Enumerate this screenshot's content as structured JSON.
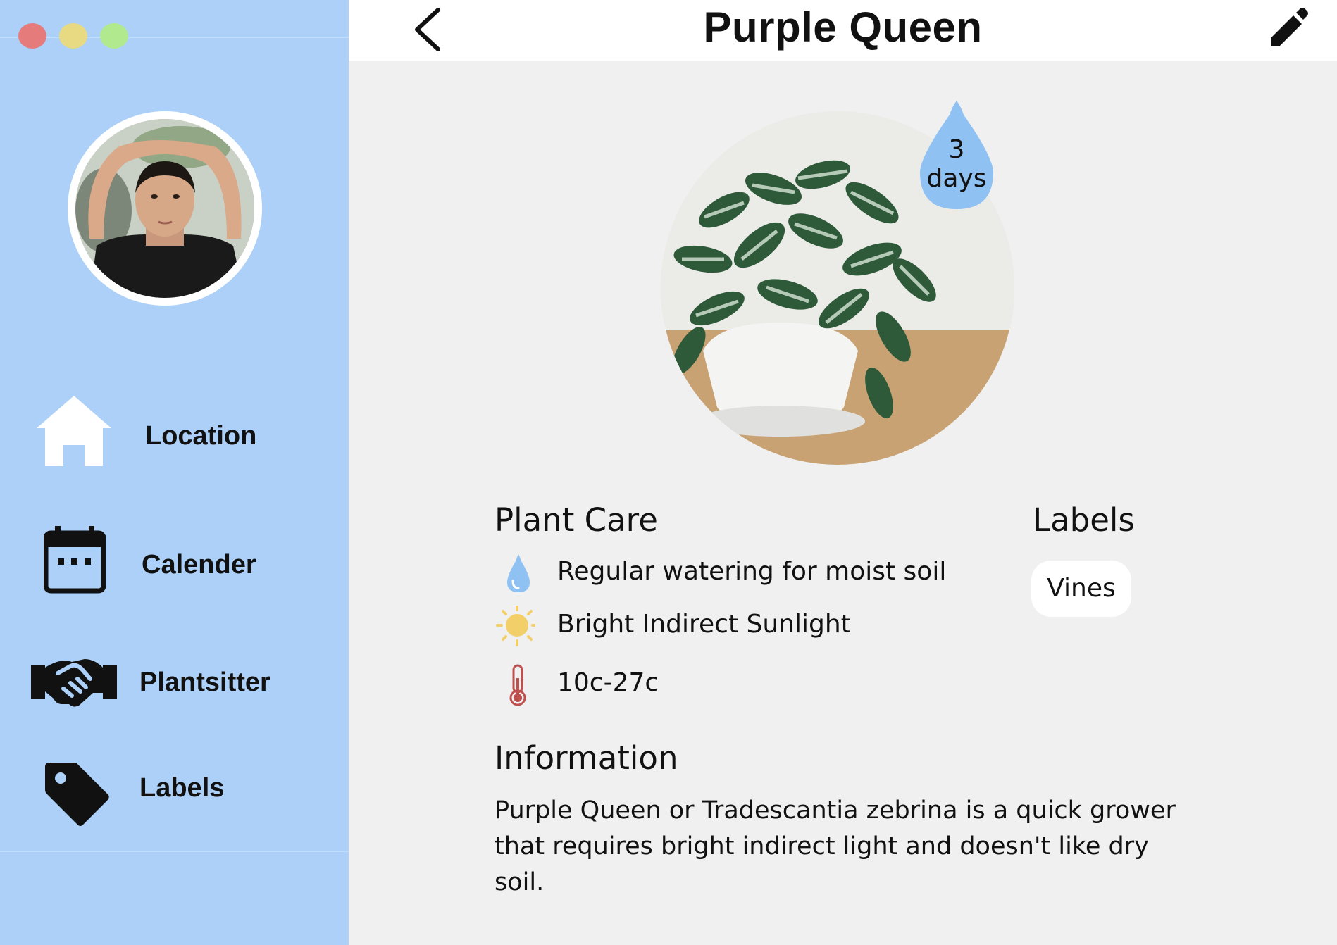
{
  "window": {
    "controls": {
      "close": "#e57b7b",
      "minimize": "#e8da82",
      "maximize": "#b1e98e"
    }
  },
  "sidebar": {
    "background": "#acd0f8",
    "items": [
      {
        "label": "Location",
        "icon": "home-icon"
      },
      {
        "label": "Calender",
        "icon": "calendar-icon"
      },
      {
        "label": "Plantsitter",
        "icon": "handshake-icon"
      },
      {
        "label": "Labels",
        "icon": "tag-icon"
      }
    ]
  },
  "header": {
    "title": "Purple Queen",
    "back_icon": "chevron-left-icon",
    "edit_icon": "pencil-icon"
  },
  "plant": {
    "water_in": {
      "value": "3",
      "unit": "days",
      "color": "#8fc1f3"
    }
  },
  "plant_care": {
    "title": "Plant Care",
    "items": [
      {
        "icon": "water-drop-icon",
        "text": "Regular watering for moist soil"
      },
      {
        "icon": "sun-icon",
        "text": "Bright Indirect Sunlight"
      },
      {
        "icon": "thermometer-icon",
        "text": "10c-27c"
      }
    ]
  },
  "labels": {
    "title": "Labels",
    "items": [
      "Vines"
    ]
  },
  "information": {
    "title": "Information",
    "line1": "Purple Queen or Tradescantia zebrina is a quick grower",
    "line2": "that requires bright indirect light and doesn't like dry soil."
  }
}
